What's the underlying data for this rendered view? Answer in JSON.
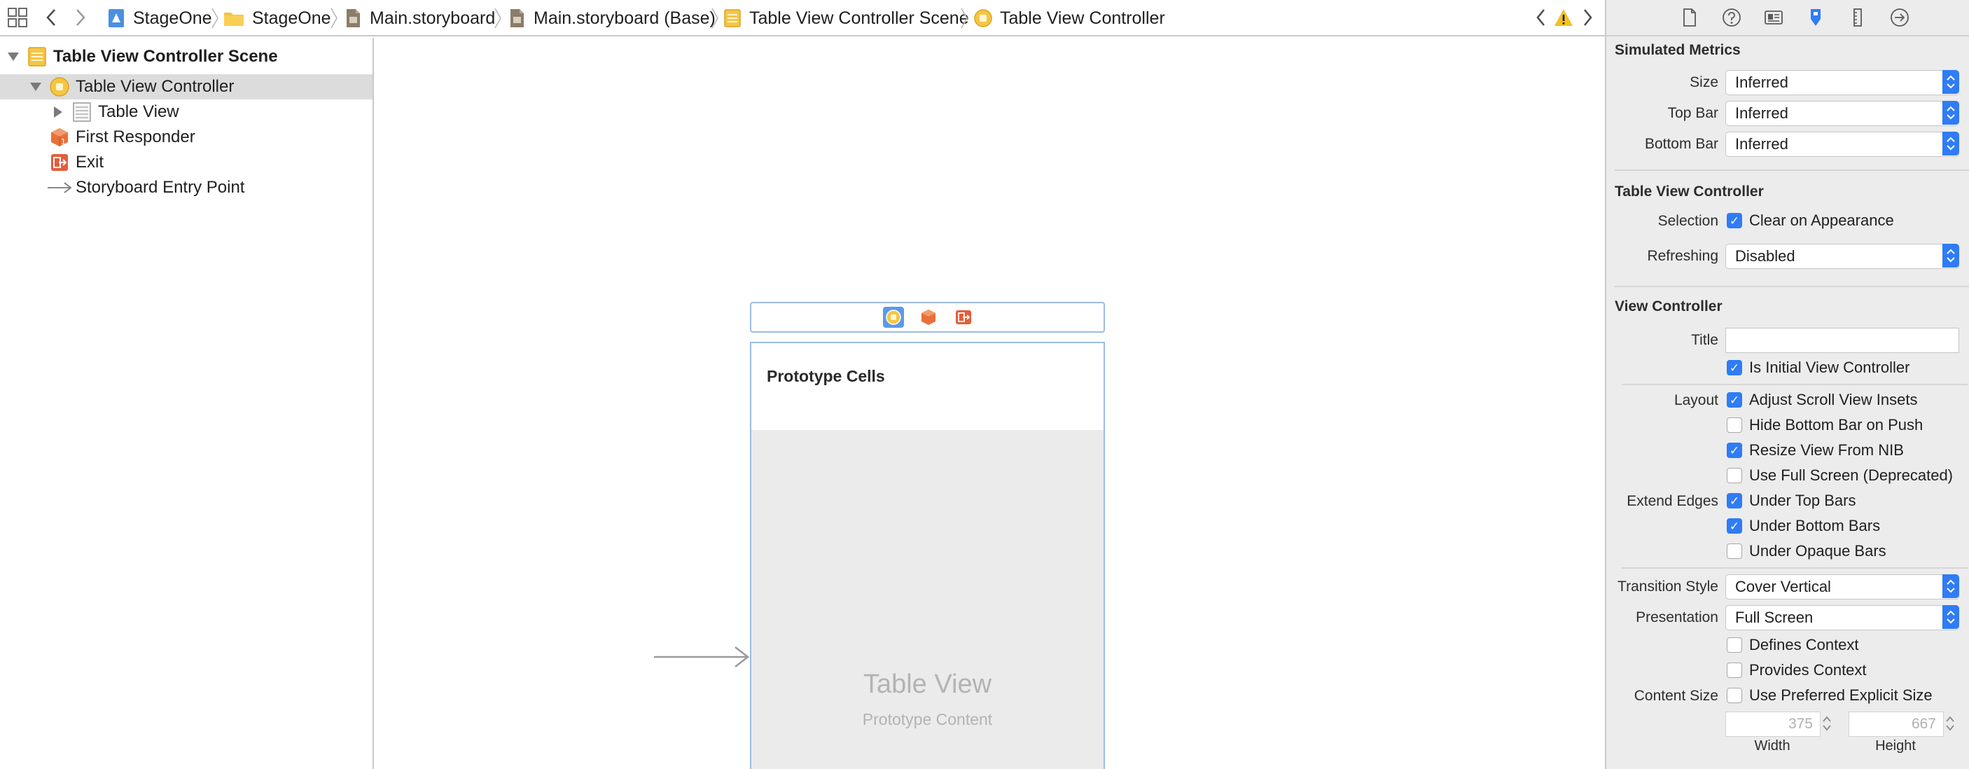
{
  "toolbar": {
    "breadcrumbs": [
      {
        "label": "StageOne",
        "icon": "project-icon"
      },
      {
        "label": "StageOne",
        "icon": "folder-icon"
      },
      {
        "label": "Main.storyboard",
        "icon": "storyboard-file-icon"
      },
      {
        "label": "Main.storyboard (Base)",
        "icon": "storyboard-file-icon"
      },
      {
        "label": "Table View Controller Scene",
        "icon": "scene-icon"
      },
      {
        "label": "Table View Controller",
        "icon": "view-controller-icon"
      }
    ]
  },
  "outline": {
    "scene_label": "Table View Controller Scene",
    "controller_label": "Table View Controller",
    "table_view_label": "Table View",
    "first_responder_label": "First Responder",
    "exit_label": "Exit",
    "entry_point_label": "Storyboard Entry Point"
  },
  "canvas": {
    "prototype_cells_label": "Prototype Cells",
    "table_view_label": "Table View",
    "prototype_content_label": "Prototype Content"
  },
  "inspector": {
    "simulated_metrics": {
      "title": "Simulated Metrics",
      "size_label": "Size",
      "size_value": "Inferred",
      "top_bar_label": "Top Bar",
      "top_bar_value": "Inferred",
      "bottom_bar_label": "Bottom Bar",
      "bottom_bar_value": "Inferred"
    },
    "table_view_controller": {
      "title": "Table View Controller",
      "selection_label": "Selection",
      "clear_on_appearance": {
        "label": "Clear on Appearance",
        "checked": true
      },
      "refreshing_label": "Refreshing",
      "refreshing_value": "Disabled"
    },
    "view_controller": {
      "title": "View Controller",
      "title_label": "Title",
      "title_value": "",
      "is_initial": {
        "label": "Is Initial View Controller",
        "checked": true
      },
      "layout_label": "Layout",
      "adjust_scroll": {
        "label": "Adjust Scroll View Insets",
        "checked": true
      },
      "hide_bottom_bar": {
        "label": "Hide Bottom Bar on Push",
        "checked": false
      },
      "resize_view": {
        "label": "Resize View From NIB",
        "checked": true
      },
      "use_full_screen": {
        "label": "Use Full Screen (Deprecated)",
        "checked": false
      },
      "extend_edges_label": "Extend Edges",
      "under_top_bars": {
        "label": "Under Top Bars",
        "checked": true
      },
      "under_bottom_bars": {
        "label": "Under Bottom Bars",
        "checked": true
      },
      "under_opaque_bars": {
        "label": "Under Opaque Bars",
        "checked": false
      },
      "transition_style_label": "Transition Style",
      "transition_style_value": "Cover Vertical",
      "presentation_label": "Presentation",
      "presentation_value": "Full Screen",
      "defines_context": {
        "label": "Defines Context",
        "checked": false
      },
      "provides_context": {
        "label": "Provides Context",
        "checked": false
      },
      "content_size_label": "Content Size",
      "preferred_size": {
        "label": "Use Preferred Explicit Size",
        "checked": false
      },
      "width_value": "375",
      "height_value": "667",
      "width_label": "Width",
      "height_label": "Height"
    }
  },
  "colors": {
    "accent": "#2f7cf6",
    "selection": "#dcdcdc",
    "inspector_bg": "#ececec"
  }
}
